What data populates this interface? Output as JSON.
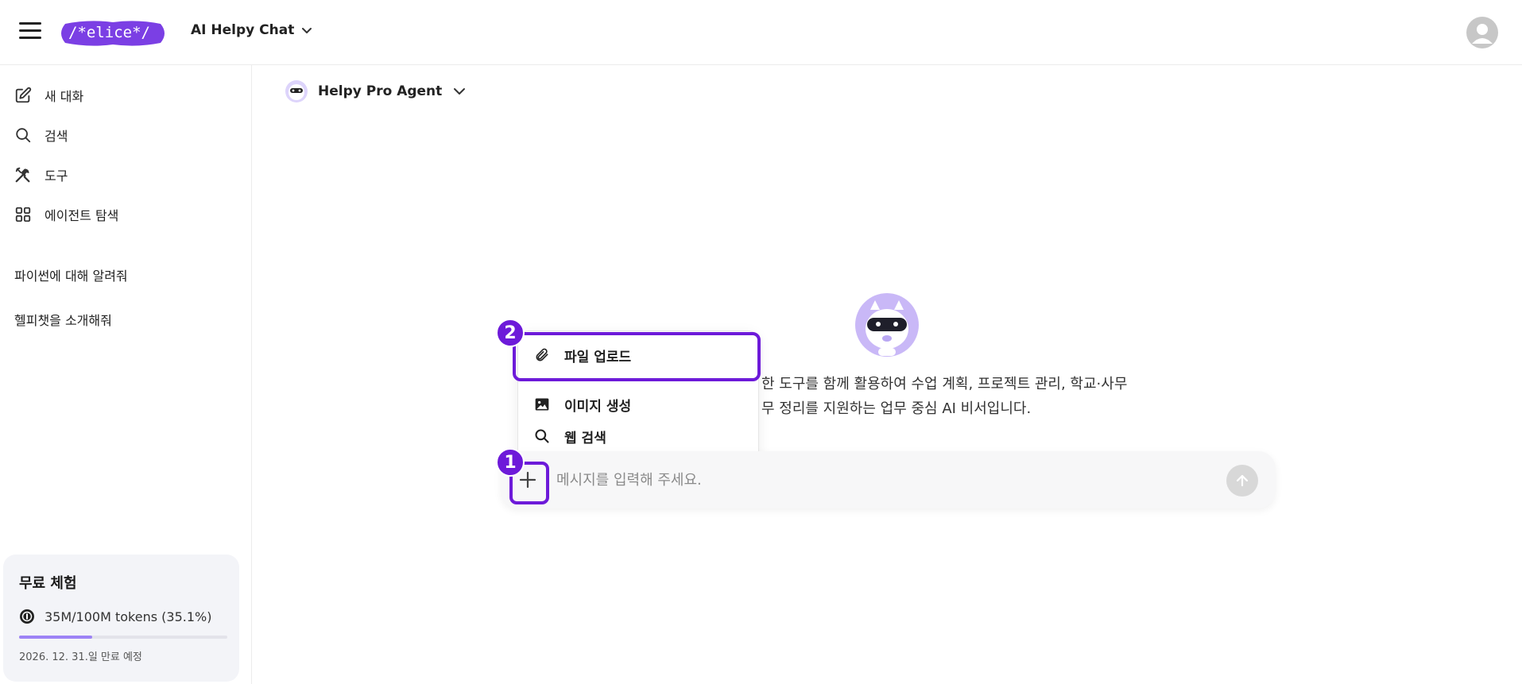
{
  "header": {
    "logo_text": "/*elice*/",
    "app_title": "AI Helpy Chat"
  },
  "sidebar": {
    "nav": [
      {
        "label": "새 대화",
        "icon": "edit-icon"
      },
      {
        "label": "검색",
        "icon": "search-icon"
      },
      {
        "label": "도구",
        "icon": "tools-icon"
      },
      {
        "label": "에이전트 탐색",
        "icon": "grid-icon"
      }
    ],
    "recent": [
      {
        "label": "파이썬에 대해 알려줘"
      },
      {
        "label": "헬피챗을 소개해줘"
      }
    ],
    "trial": {
      "title": "무료 체험",
      "usage": "35M/100M tokens (35.1%)",
      "progress_fraction": 0.351,
      "expiry": "2026. 12. 31.일 만료 예정"
    }
  },
  "main": {
    "agent_name": "Helpy Pro Agent",
    "intro_line1": "한 도구를 함께 활용하여 수업 계획, 프로젝트 관리, 학교·사무",
    "intro_line2": "무 정리를 지원하는 업무 중심 AI 비서입니다.",
    "input_placeholder": "메시지를 입력해 주세요.",
    "menu": [
      {
        "label": "파일 업로드",
        "icon": "paperclip-icon"
      },
      {
        "label": "이미지 생성",
        "icon": "image-icon"
      },
      {
        "label": "웹 검색",
        "icon": "search-icon"
      }
    ],
    "step_badges": [
      "1",
      "2"
    ]
  },
  "colors": {
    "accent": "#6d1ad9",
    "brand": "#7b3fe4",
    "progress": "#9d83f5"
  }
}
